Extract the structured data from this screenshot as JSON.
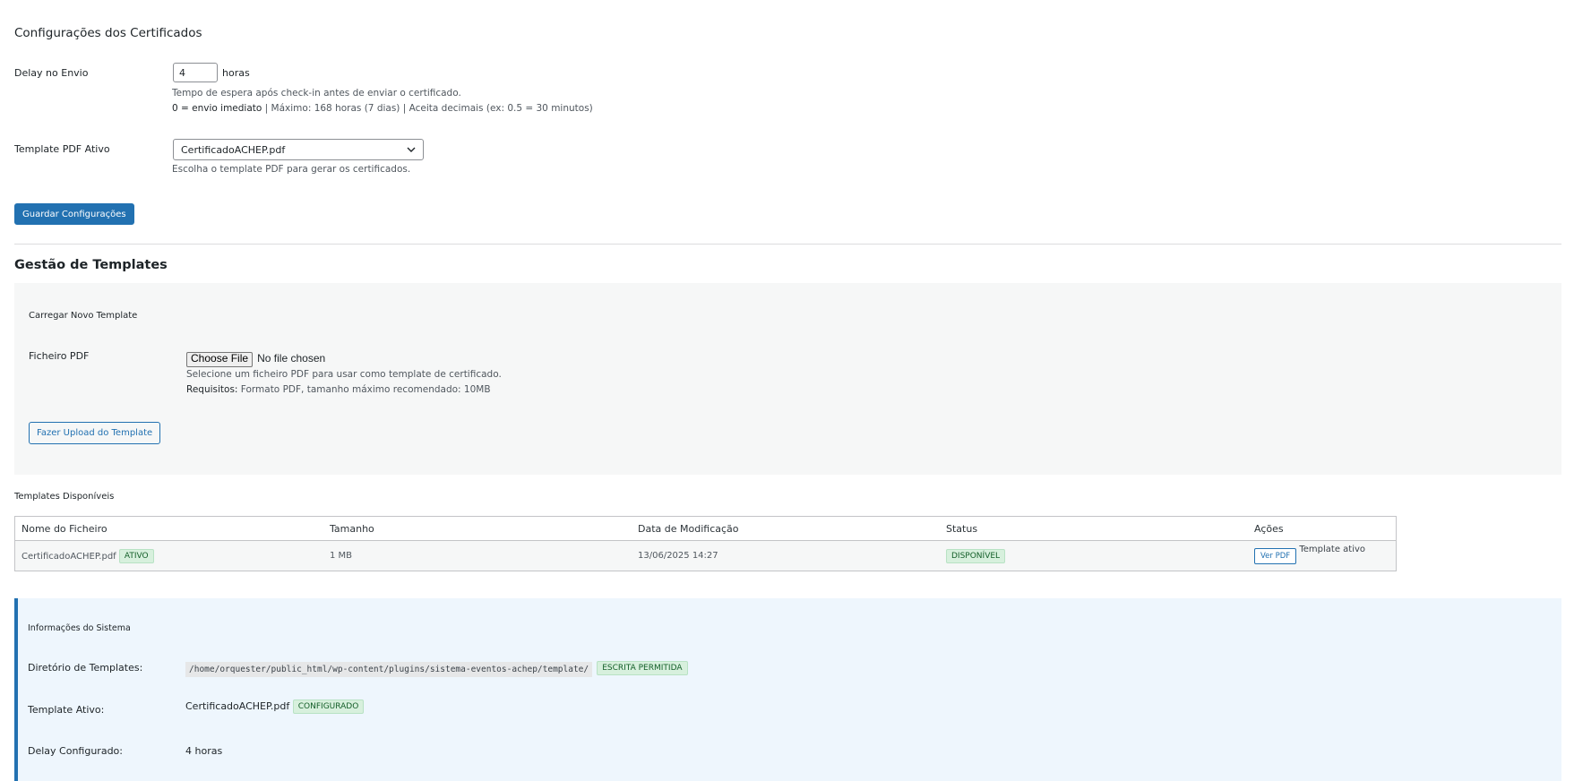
{
  "settings": {
    "title": "Configurações dos Certificados",
    "delay": {
      "label": "Delay no Envio",
      "value": "4",
      "unit": "horas",
      "help1": "Tempo de espera após check-in antes de enviar o certificado.",
      "help2_strong": "0 = envio imediato",
      "help2_rest": " | Máximo: 168 horas (7 dias) | Aceita decimais (ex: 0.5 = 30 minutos)"
    },
    "template": {
      "label": "Template PDF Ativo",
      "selected": "CertificadoACHEP.pdf",
      "help": "Escolha o template PDF para gerar os certificados."
    },
    "save_button": "Guardar Configurações"
  },
  "templates": {
    "title": "Gestão de Templates",
    "upload": {
      "heading": "Carregar Novo Template",
      "file_label": "Ficheiro PDF",
      "choose_button": "Choose File",
      "no_file": "No file chosen",
      "help1": "Selecione um ficheiro PDF para usar como template de certificado.",
      "help2_strong": "Requisitos:",
      "help2_rest": " Formato PDF, tamanho máximo recomendado: 10MB",
      "upload_button": "Fazer Upload do Template"
    },
    "available_title": "Templates Disponíveis",
    "columns": [
      "Nome do Ficheiro",
      "Tamanho",
      "Data de Modificação",
      "Status",
      "Ações"
    ],
    "rows": [
      {
        "name": "CertificadoACHEP.pdf",
        "badge": "ATIVO",
        "size": "1 MB",
        "modified": "13/06/2025 14:27",
        "status": "DISPONÍVEL",
        "action_button": "Ver PDF",
        "action_note": "Template ativo"
      }
    ]
  },
  "system": {
    "heading": "Informações do Sistema",
    "dir_label": "Diretório de Templates:",
    "dir_value": "/home/orquester/public_html/wp-content/plugins/sistema-eventos-achep/template/",
    "dir_badge": "ESCRITA PERMITIDA",
    "active_label": "Template Ativo:",
    "active_value": "CertificadoACHEP.pdf",
    "active_badge": "CONFIGURADO",
    "delay_label": "Delay Configurado:",
    "delay_value": "4 horas"
  },
  "colors": {
    "primary": "#2271b1",
    "badge_green_bg": "#d7f0dd",
    "badge_green_text": "#135e28",
    "info_panel_bg": "#eef6fd"
  }
}
